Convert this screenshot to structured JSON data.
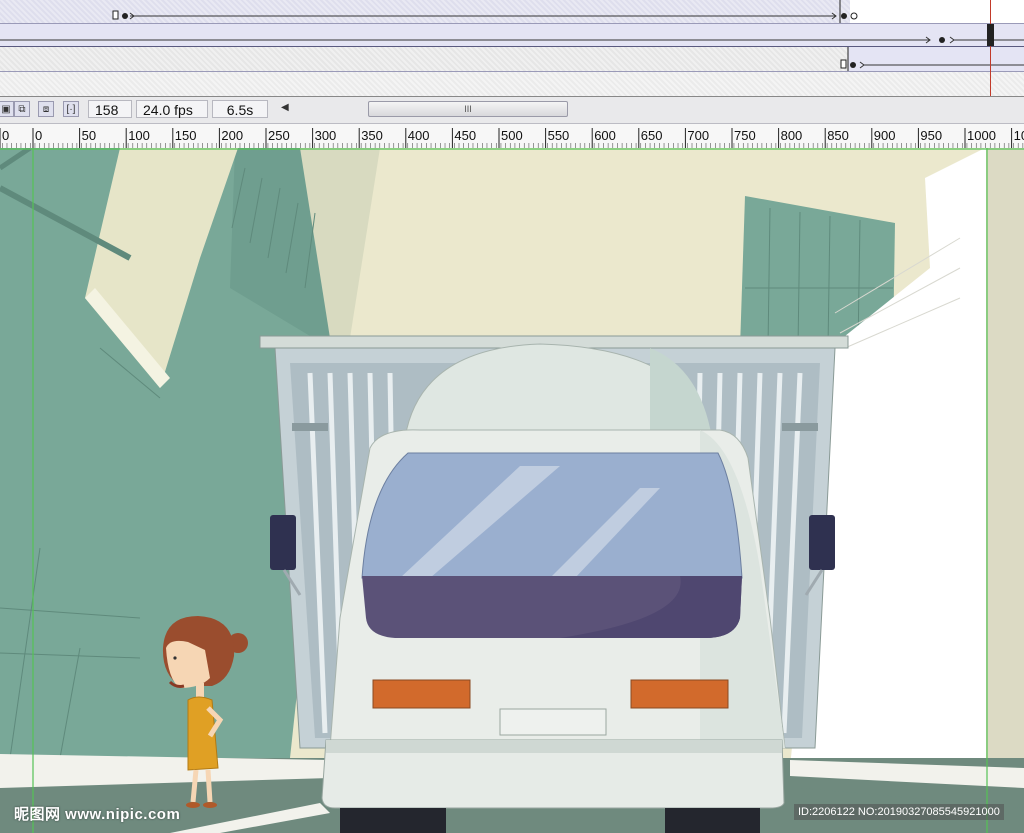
{
  "controls": {
    "frame": "158",
    "fps": "24.0 fps",
    "time": "6.5s",
    "scroll_grip": "III"
  },
  "ruler": {
    "ticks": [
      "0",
      "0",
      "50",
      "100",
      "150",
      "200",
      "250",
      "300",
      "350",
      "400",
      "450",
      "500",
      "550",
      "600",
      "650",
      "700",
      "750",
      "800",
      "850",
      "900",
      "950",
      "1000",
      "10"
    ]
  },
  "watermark": {
    "site": "昵图网 www.nipic.com",
    "id_text": "ID:2206122 NO:20190327085545921000"
  },
  "icons": [
    "distribute-icon",
    "copy-icon",
    "paste-icon",
    "fit-frame-icon",
    "scroll-left-icon"
  ],
  "colors": {
    "playhead": "#c23a2a",
    "building_green": "#79a898",
    "sky_cream": "#ebe8cd",
    "windshield": "#9aafcf",
    "skirt": "#5b5278",
    "taillight": "#d26a2c",
    "dress": "#e0a024"
  }
}
